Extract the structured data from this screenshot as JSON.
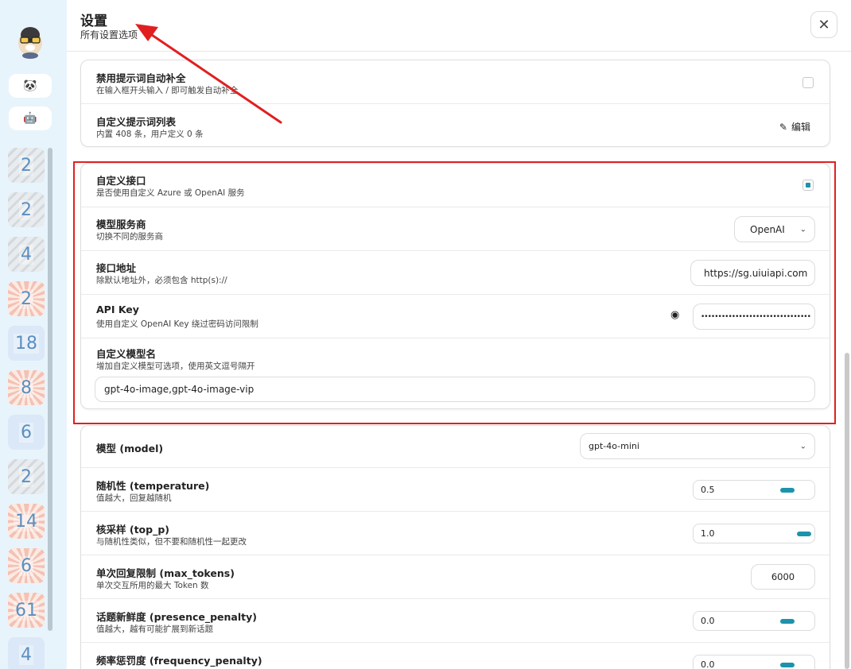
{
  "header": {
    "title": "设置",
    "subtitle": "所有设置选项"
  },
  "sidebar": {
    "mask_badges": [
      "2",
      "2",
      "4",
      "2",
      "18",
      "8",
      "6",
      "2",
      "14",
      "6",
      "61",
      "4"
    ]
  },
  "prompt_card": {
    "disable_autocomplete": {
      "title": "禁用提示词自动补全",
      "desc": "在输入框开头输入 / 即可触发自动补全",
      "checked": false
    },
    "custom_prompts": {
      "title": "自定义提示词列表",
      "desc": "内置 408 条，用户定义 0 条",
      "button": "编辑"
    }
  },
  "custom_api_card": {
    "use_custom": {
      "title": "自定义接口",
      "desc": "是否使用自定义 Azure 或 OpenAI 服务",
      "checked": true
    },
    "provider": {
      "title": "模型服务商",
      "desc": "切换不同的服务商",
      "value": "OpenAI"
    },
    "endpoint": {
      "title": "接口地址",
      "desc": "除默认地址外，必须包含 http(s)://",
      "value": "https://sg.uiuiapi.com"
    },
    "api_key": {
      "title": "API Key",
      "desc": "使用自定义 OpenAI Key 绕过密码访问限制",
      "value": "••••••••••••••••••••••••••••••••"
    },
    "custom_models": {
      "title": "自定义模型名",
      "desc": "增加自定义模型可选项，使用英文逗号隔开",
      "value": "gpt-4o-image,gpt-4o-image-vip"
    }
  },
  "model_card": {
    "model": {
      "title": "模型 (model)",
      "value": "gpt-4o-mini"
    },
    "temperature": {
      "title": "随机性 (temperature)",
      "desc": "值越大，回复越随机",
      "value": "0.5",
      "level": 0.5
    },
    "top_p": {
      "title": "核采样 (top_p)",
      "desc": "与随机性类似，但不要和随机性一起更改",
      "value": "1.0",
      "level": 1.0
    },
    "max_tokens": {
      "title": "单次回复限制 (max_tokens)",
      "desc": "单次交互所用的最大 Token 数",
      "value": "6000"
    },
    "presence_penalty": {
      "title": "话题新鲜度 (presence_penalty)",
      "desc": "值越大，越有可能扩展到新话题",
      "value": "0.0",
      "level": 0.5
    },
    "frequency_penalty": {
      "title": "频率惩罚度 (frequency_penalty)",
      "value": "0.0",
      "level": 0.5
    }
  },
  "colors": {
    "accent": "#1d93ab",
    "annotation_red": "#e02020",
    "sidebar_bg": "#e8f4fb"
  }
}
